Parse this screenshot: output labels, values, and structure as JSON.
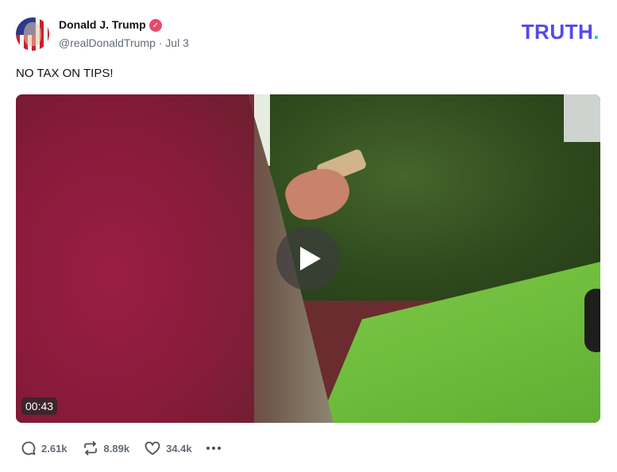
{
  "author": {
    "name": "Donald J. Trump",
    "meta": "@realDonaldTrump · Jul 3",
    "verified": "✓"
  },
  "brand": {
    "logo_text": "TRUTH",
    "logo_dot": ".",
    "logo_color": "#5448ee",
    "dot_color": "#17d4c9"
  },
  "post": {
    "text": "NO TAX ON TIPS!"
  },
  "video": {
    "duration": "00:43"
  },
  "actions": {
    "replies": "2.61k",
    "retruths": "8.89k",
    "likes": "34.4k"
  },
  "colors": {
    "verified_badge": "#e64a6b",
    "muted_text": "#636b76"
  }
}
